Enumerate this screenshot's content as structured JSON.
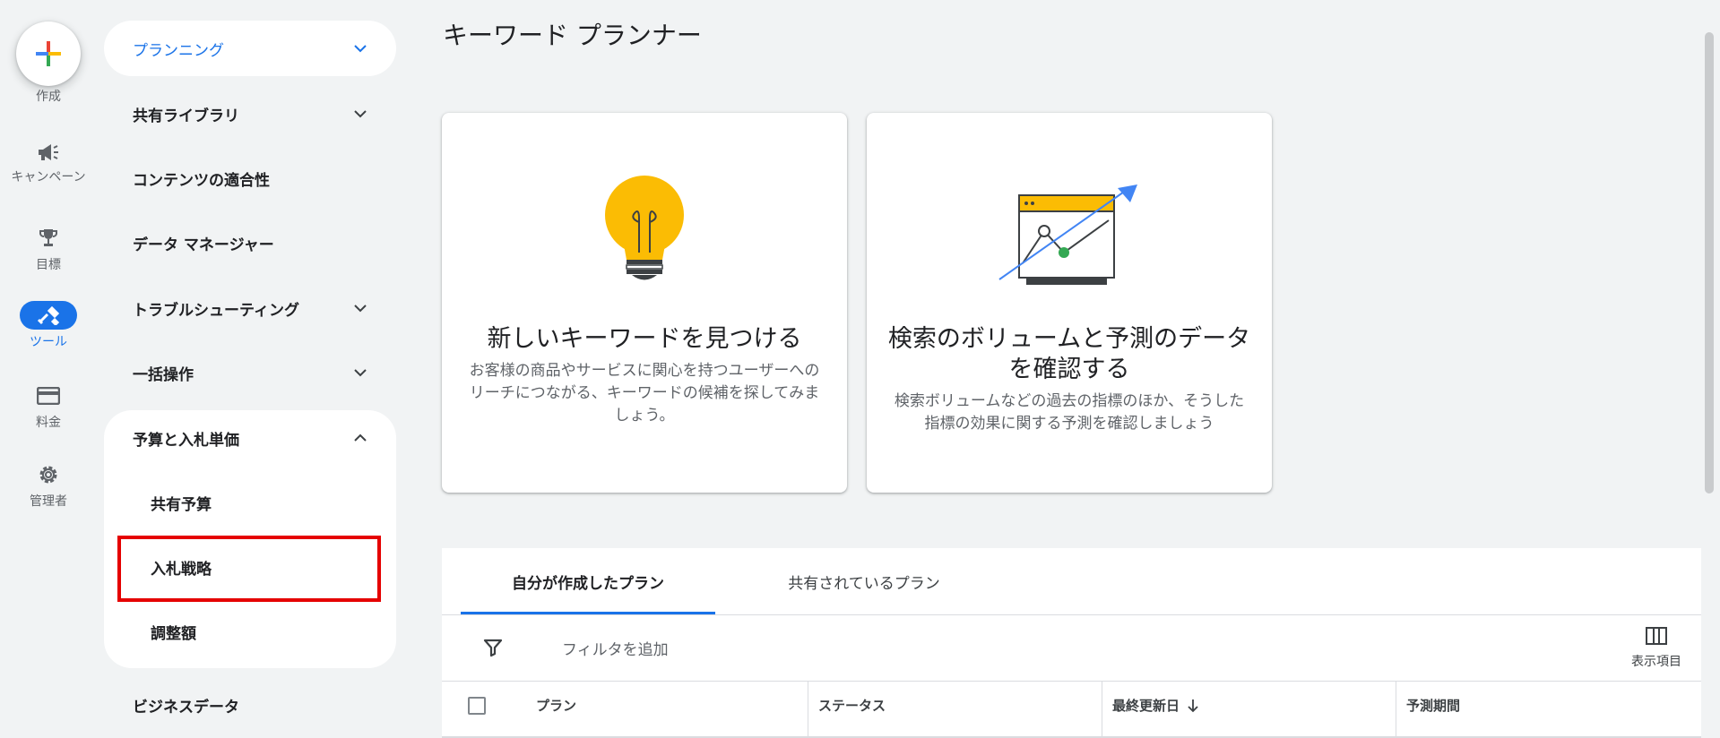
{
  "rail": {
    "create_label": "作成",
    "campaign_label": "キャンペーン",
    "goals_label": "目標",
    "tools_label": "ツール",
    "billing_label": "料金",
    "admin_label": "管理者"
  },
  "nav": {
    "planning": "プランニング",
    "shared_library": "共有ライブラリ",
    "content_suitability": "コンテンツの適合性",
    "data_manager": "データ マネージャー",
    "troubleshooting": "トラブルシューティング",
    "bulk_actions": "一括操作",
    "budgets_bidding": "予算と入札単価",
    "shared_budgets": "共有予算",
    "bid_strategies": "入札戦略",
    "adjustments": "調整額",
    "business_data": "ビジネスデータ"
  },
  "main": {
    "title": "キーワード プランナー",
    "card1": {
      "title": "新しいキーワードを見つける",
      "desc": "お客様の商品やサービスに関心を持つユーザーへのリーチにつながる、キーワードの候補を探してみましょう。",
      "icon": "lightbulb-illustration"
    },
    "card2": {
      "title": "検索のボリュームと予測のデータを確認する",
      "desc": "検索ボリュームなどの過去の指標のほか、そうした指標の効果に関する予測を確認しましょう",
      "icon": "trend-chart-illustration"
    },
    "tabs": [
      "自分が作成したプラン",
      "共有されているプラン"
    ],
    "filter_label": "フィルタを追加",
    "columns_label": "表示項目",
    "table_headers": [
      "プラン",
      "ステータス",
      "最終更新日",
      "予測期間"
    ]
  },
  "colors": {
    "accent": "#1a73e8",
    "highlight": "#e50000",
    "bulb": "#fbbc04",
    "green": "#34a853"
  }
}
